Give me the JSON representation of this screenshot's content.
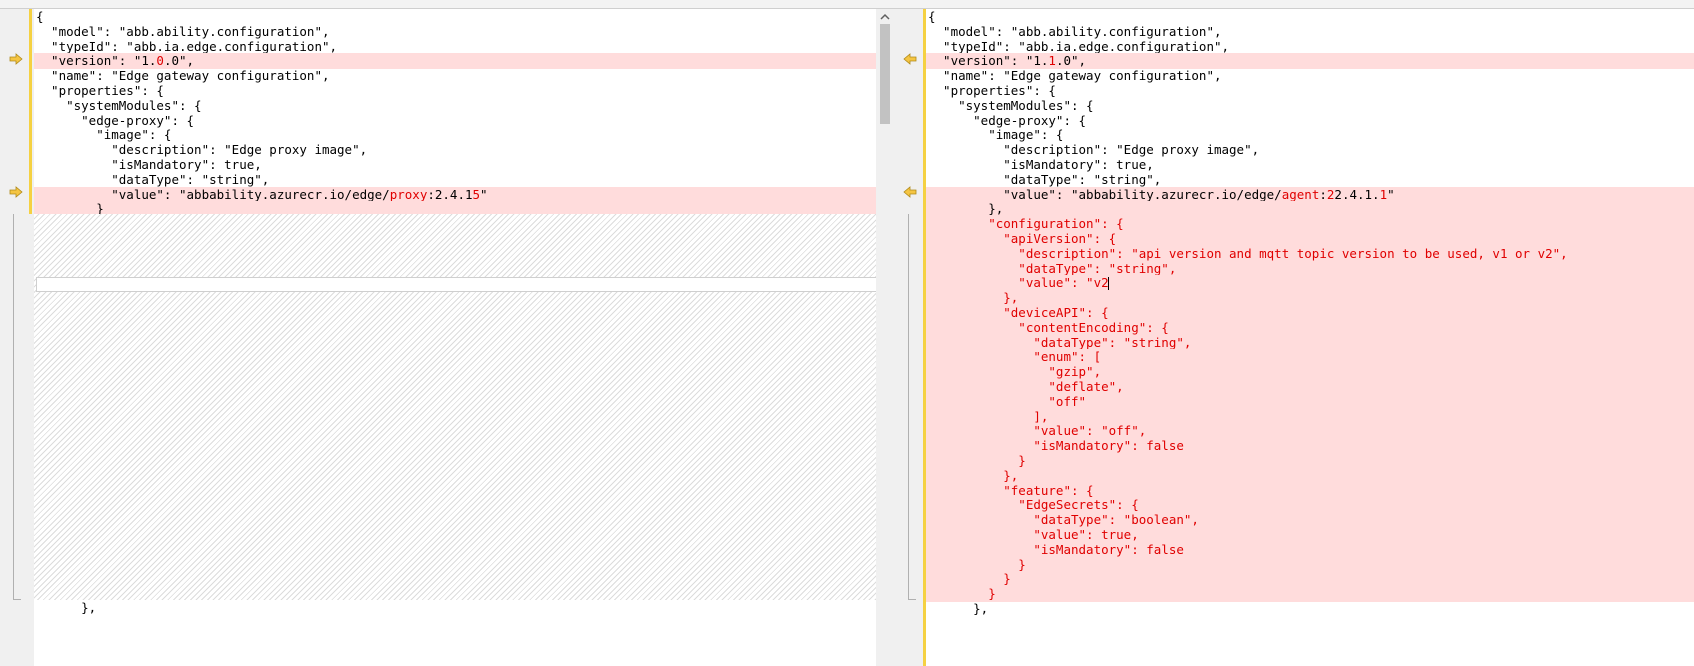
{
  "colors": {
    "diff_bg": "#ffdcdc",
    "changed_text": "#e00000",
    "marker_yellow": "#f5d142"
  },
  "left": {
    "lines": [
      {
        "t": "{",
        "d": false
      },
      {
        "t": "  \"model\": \"abb.ability.configuration\",",
        "d": false
      },
      {
        "t": "  \"typeId\": \"abb.ia.edge.configuration\",",
        "d": false
      },
      {
        "t": "  \"version\": \"1.",
        "r": "0",
        "a": ".0\",",
        "d": true
      },
      {
        "t": "  \"name\": \"Edge gateway configuration\",",
        "d": false
      },
      {
        "t": "  \"properties\": {",
        "d": false
      },
      {
        "t": "    \"systemModules\": {",
        "d": false
      },
      {
        "t": "      \"edge-proxy\": {",
        "d": false
      },
      {
        "t": "        \"image\": {",
        "d": false
      },
      {
        "t": "          \"description\": \"Edge proxy image\",",
        "d": false
      },
      {
        "t": "          \"isMandatory\": true,",
        "d": false
      },
      {
        "t": "          \"dataType\": \"string\",",
        "d": false
      },
      {
        "t": "          \"value\": \"abbability.azurecr.io/edge/",
        "r": "proxy",
        "a": ":2.4.1",
        "r2": "5",
        "a2": "\"",
        "d": true
      },
      {
        "t": "        }",
        "d": true
      }
    ],
    "last_line": "      },"
  },
  "right": {
    "lines": [
      {
        "t": "{",
        "d": false
      },
      {
        "t": "  \"model\": \"abb.ability.configuration\",",
        "d": false
      },
      {
        "t": "  \"typeId\": \"abb.ia.edge.configuration\",",
        "d": false
      },
      {
        "t": "  \"version\": \"1.",
        "r": "1",
        "a": ".0\",",
        "d": true
      },
      {
        "t": "  \"name\": \"Edge gateway configuration\",",
        "d": false
      },
      {
        "t": "  \"properties\": {",
        "d": false
      },
      {
        "t": "    \"systemModules\": {",
        "d": false
      },
      {
        "t": "      \"edge-proxy\": {",
        "d": false
      },
      {
        "t": "        \"image\": {",
        "d": false
      },
      {
        "t": "          \"description\": \"Edge proxy image\",",
        "d": false
      },
      {
        "t": "          \"isMandatory\": true,",
        "d": false
      },
      {
        "t": "          \"dataType\": \"string\",",
        "d": false
      },
      {
        "t": "          \"value\": \"abbability.azurecr.io/edge/",
        "r": "agent",
        "a": ":",
        "r2": "2",
        "a2": "2.4.1.",
        "r3": "1",
        "a3": "\"",
        "d": true
      },
      {
        "t": "        },",
        "d": true
      },
      {
        "t": "",
        "r": "        \"configuration\": {",
        "d": true
      },
      {
        "t": "",
        "r": "          \"apiVersion\": {",
        "d": true
      },
      {
        "t": "",
        "r": "            \"description\": \"api version and mqtt topic version to be used, v1 or v2\",",
        "d": true
      },
      {
        "t": "",
        "r": "            \"dataType\": \"string\",",
        "d": true
      },
      {
        "t": "",
        "r": "            \"value\": \"v2",
        "caret": true,
        "d": true
      },
      {
        "t": "",
        "r": "          },",
        "d": true
      },
      {
        "t": "",
        "r": "          \"deviceAPI\": {",
        "d": true
      },
      {
        "t": "",
        "r": "            \"contentEncoding\": {",
        "d": true
      },
      {
        "t": "",
        "r": "              \"dataType\": \"string\",",
        "d": true
      },
      {
        "t": "",
        "r": "              \"enum\": [",
        "d": true
      },
      {
        "t": "",
        "r": "                \"gzip\",",
        "d": true
      },
      {
        "t": "",
        "r": "                \"deflate\",",
        "d": true
      },
      {
        "t": "",
        "r": "                \"off\"",
        "d": true
      },
      {
        "t": "",
        "r": "              ],",
        "d": true
      },
      {
        "t": "",
        "r": "              \"value\": \"off\",",
        "d": true
      },
      {
        "t": "",
        "r": "              \"isMandatory\": false",
        "d": true
      },
      {
        "t": "",
        "r": "            }",
        "d": true
      },
      {
        "t": "",
        "r": "          },",
        "d": true
      },
      {
        "t": "",
        "r": "          \"feature\": {",
        "d": true
      },
      {
        "t": "",
        "r": "            \"EdgeSecrets\": {",
        "d": true
      },
      {
        "t": "",
        "r": "              \"dataType\": \"boolean\",",
        "d": true
      },
      {
        "t": "",
        "r": "              \"value\": true,",
        "d": true
      },
      {
        "t": "",
        "r": "              \"isMandatory\": false",
        "d": true
      },
      {
        "t": "",
        "r": "            }",
        "d": true
      },
      {
        "t": "",
        "r": "          }",
        "d": true
      },
      {
        "t": "",
        "r": "        }",
        "d": true
      },
      {
        "t": "      },",
        "d": false
      }
    ]
  },
  "icons": {
    "left_marker": "arrow-right-icon",
    "right_marker": "arrow-left-icon",
    "scroll_up": "chevron-up-icon"
  }
}
